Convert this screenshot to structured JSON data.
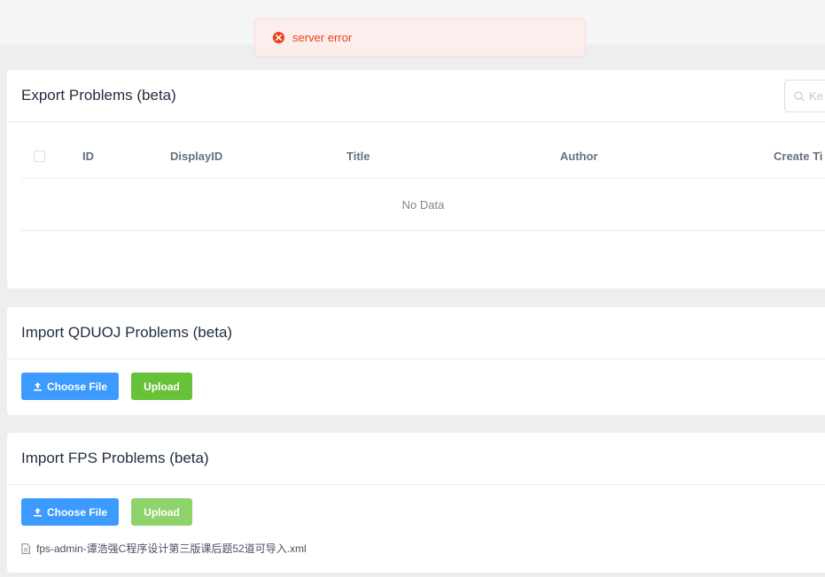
{
  "notification": {
    "text": "server error",
    "type": "error",
    "color": "#ed4014"
  },
  "export": {
    "title": "Export Problems (beta)",
    "search_placeholder": "Ke",
    "columns": [
      "ID",
      "DisplayID",
      "Title",
      "Author",
      "Create Ti"
    ],
    "empty_text": "No Data"
  },
  "import_qduoj": {
    "title": "Import QDUOJ Problems (beta)",
    "choose_label": "Choose File",
    "upload_label": "Upload"
  },
  "import_fps": {
    "title": "Import FPS Problems (beta)",
    "choose_label": "Choose File",
    "upload_label": "Upload",
    "file_name": "fps-admin-谭浩强C程序设计第三版课后题52道可导入.xml"
  },
  "colors": {
    "primary": "#3d9aff",
    "success": "#67c23a",
    "error": "#ed4014"
  },
  "icons": [
    "close-circle-icon",
    "search-icon",
    "upload-icon",
    "document-icon"
  ]
}
